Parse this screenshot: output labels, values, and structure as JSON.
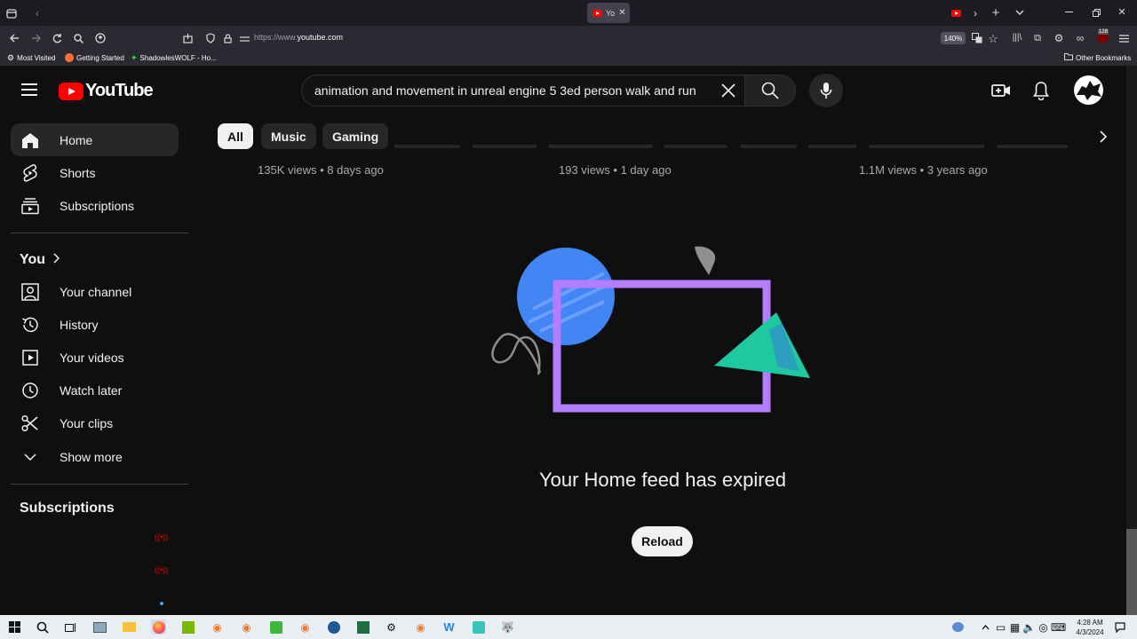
{
  "browser": {
    "tab_title": "Yo",
    "url_scheme": "https://www.",
    "url_host": "youtube.com",
    "zoom": "140%",
    "bookmarks": [
      {
        "label": "Most Visited"
      },
      {
        "label": "Getting Started"
      },
      {
        "label": "ShadowlesWOLF - Ho..."
      }
    ],
    "other_bookmarks": "Other Bookmarks",
    "addon_badge": "128"
  },
  "header": {
    "logo_text": "YouTube",
    "search_query": "animation and movement in unreal engine 5 3ed person walk and run"
  },
  "sidebar": {
    "main": [
      {
        "label": "Home",
        "icon": "home-icon"
      },
      {
        "label": "Shorts",
        "icon": "shorts-icon"
      },
      {
        "label": "Subscriptions",
        "icon": "subscriptions-icon"
      }
    ],
    "you_heading": "You",
    "you_items": [
      {
        "label": "Your channel",
        "icon": "channel-icon"
      },
      {
        "label": "History",
        "icon": "history-icon"
      },
      {
        "label": "Your videos",
        "icon": "video-icon"
      },
      {
        "label": "Watch later",
        "icon": "clock-icon"
      },
      {
        "label": "Your clips",
        "icon": "scissors-icon"
      },
      {
        "label": "Show more",
        "icon": "chevron-down-icon"
      }
    ],
    "subscriptions_heading": "Subscriptions"
  },
  "chips": [
    {
      "label": "All",
      "selected": true
    },
    {
      "label": "Music",
      "selected": false
    },
    {
      "label": "Gaming",
      "selected": false
    }
  ],
  "partial_videos": [
    {
      "meta": "135K views • 8 days ago"
    },
    {
      "meta": "193 views • 1 day ago"
    },
    {
      "meta": "1.1M views • 3 years ago"
    }
  ],
  "empty_state": {
    "title": "Your Home feed has expired",
    "button": "Reload"
  },
  "taskbar": {
    "time": "4:28 AM",
    "date": "4/3/2024"
  },
  "colors": {
    "accent_red": "#ff0000",
    "illustration_blue": "#4285f4",
    "illustration_purple": "#b47cff",
    "illustration_teal": "#1ec8a0"
  }
}
